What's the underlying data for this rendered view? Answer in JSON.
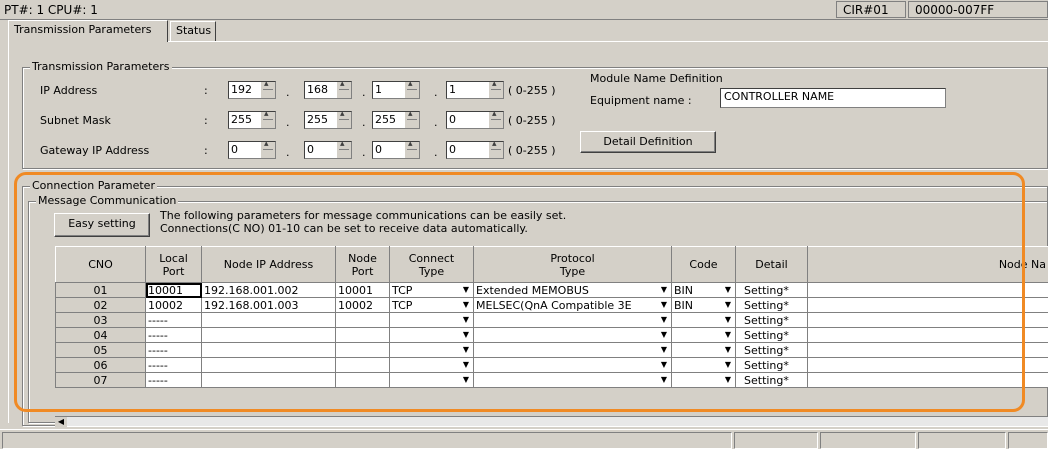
{
  "titlebar": {
    "left": "PT#: 1 CPU#: 1",
    "cir": "CIR#01",
    "range": "00000-007FF"
  },
  "tabs": [
    {
      "label": "Transmission Parameters"
    },
    {
      "label": "Status"
    }
  ],
  "transmission": {
    "legend": "Transmission Parameters",
    "ip": {
      "label": "IP Address",
      "colon": ":",
      "octets": [
        "192",
        "168",
        "1",
        "1"
      ],
      "range": "( 0-255 )"
    },
    "subnet": {
      "label": "Subnet Mask",
      "colon": ":",
      "octets": [
        "255",
        "255",
        "255",
        "0"
      ],
      "range": "( 0-255 )"
    },
    "gateway": {
      "label": "Gateway IP Address",
      "colon": ":",
      "octets": [
        "0",
        "0",
        "0",
        "0"
      ],
      "range": "( 0-255 )"
    },
    "sep": "."
  },
  "module": {
    "title": "Module Name Definition",
    "equip_label": "Equipment name :",
    "equip_value": "CONTROLLER NAME",
    "detail_button": "Detail Definition"
  },
  "connection": {
    "legend": "Connection Parameter",
    "msg_legend": "Message Communication",
    "easy_button": "Easy setting",
    "desc1": "The following parameters for message communications can be easily set.",
    "desc2": "Connections(C NO) 01-10 can be set to receive data automatically."
  },
  "grid": {
    "headers": [
      "CNO",
      "Local\nPort",
      "Node IP Address",
      "Node\nPort",
      "Connect\nType",
      "Protocol\nType",
      "Code",
      "Detail",
      "Node Na"
    ],
    "rows": [
      {
        "cno": "01",
        "local": "10001",
        "ip": "192.168.001.002",
        "nport": "10001",
        "ctype": "TCP",
        "ptype": "Extended MEMOBUS",
        "code": "BIN",
        "detail": "Setting*"
      },
      {
        "cno": "02",
        "local": "10002",
        "ip": "192.168.001.003",
        "nport": "10002",
        "ctype": "TCP",
        "ptype": "MELSEC(QnA Compatible 3E",
        "code": "BIN",
        "detail": "Setting*"
      },
      {
        "cno": "03",
        "local": "-----",
        "ip": "",
        "nport": "",
        "ctype": "",
        "ptype": "",
        "code": "",
        "detail": "Setting*"
      },
      {
        "cno": "04",
        "local": "-----",
        "ip": "",
        "nport": "",
        "ctype": "",
        "ptype": "",
        "code": "",
        "detail": "Setting*"
      },
      {
        "cno": "05",
        "local": "-----",
        "ip": "",
        "nport": "",
        "ctype": "",
        "ptype": "",
        "code": "",
        "detail": "Setting*"
      },
      {
        "cno": "06",
        "local": "-----",
        "ip": "",
        "nport": "",
        "ctype": "",
        "ptype": "",
        "code": "",
        "detail": "Setting*"
      },
      {
        "cno": "07",
        "local": "-----",
        "ip": "",
        "nport": "",
        "ctype": "",
        "ptype": "",
        "code": "",
        "detail": "Setting*"
      }
    ]
  },
  "colors": {
    "highlight": "#f08a24",
    "face": "#d4d0c8"
  }
}
